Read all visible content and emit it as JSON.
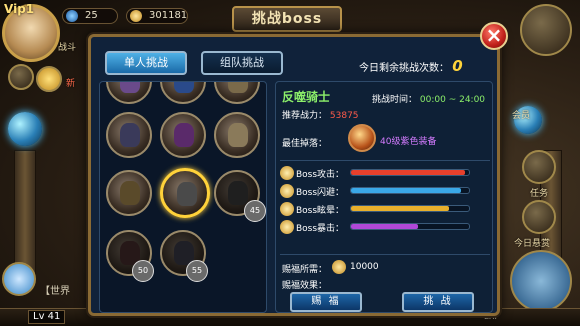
{
  "hud": {
    "vip": "Vip1",
    "gems": "25",
    "coins": "301181",
    "title": "挑战boss",
    "side_label_left": "战斗",
    "side_label_left2": "新",
    "chat_label": "【世界",
    "level": "Lv 41",
    "exp_label": "EXP",
    "right_label_1": "会员",
    "right_label_2": "任务",
    "right_label_3": "今日悬赏"
  },
  "dialog": {
    "tabs": [
      {
        "label": "单人挑战",
        "active": true
      },
      {
        "label": "组队挑战",
        "active": false
      }
    ],
    "remaining_label": "今日剩余挑战次数：",
    "remaining_count": "0",
    "boss_slots": [
      {
        "lock_level": ""
      },
      {
        "lock_level": ""
      },
      {
        "lock_level": ""
      },
      {
        "lock_level": ""
      },
      {
        "lock_level": ""
      },
      {
        "lock_level": ""
      },
      {
        "lock_level": ""
      },
      {
        "lock_level": ""
      },
      {
        "lock_level": "45"
      },
      {
        "lock_level": "50"
      },
      {
        "lock_level": "55"
      }
    ],
    "detail": {
      "name": "反噬骑士",
      "time_label": "挑战时间：",
      "time_value": "00:00 ~ 24:00",
      "power_label": "推荐战力：",
      "power_value": "53875",
      "drop_label": "最佳掉落：",
      "drop_text": "40级紫色装备",
      "stats": [
        {
          "label": "Boss攻击：",
          "fill": 0.97,
          "color": "#e8402c"
        },
        {
          "label": "Boss闪避：",
          "fill": 0.93,
          "color": "#3aa8e8"
        },
        {
          "label": "Boss眩晕：",
          "fill": 0.83,
          "color": "#e8b02c"
        },
        {
          "label": "Boss暴击：",
          "fill": 0.57,
          "color": "#b048d8"
        }
      ],
      "cost_label": "赐福所需：",
      "cost_value": "10000",
      "effect_label": "赐福效果：",
      "bless_button": "赐 福",
      "challenge_button": "挑 战"
    }
  },
  "colors": {
    "panel": "#10223a",
    "gold_frame": "#8a6a34",
    "green_text": "#8cf06a",
    "red_text": "#ff5a4a",
    "purple_text": "#d47bff",
    "count_yellow": "#ffd43a"
  }
}
